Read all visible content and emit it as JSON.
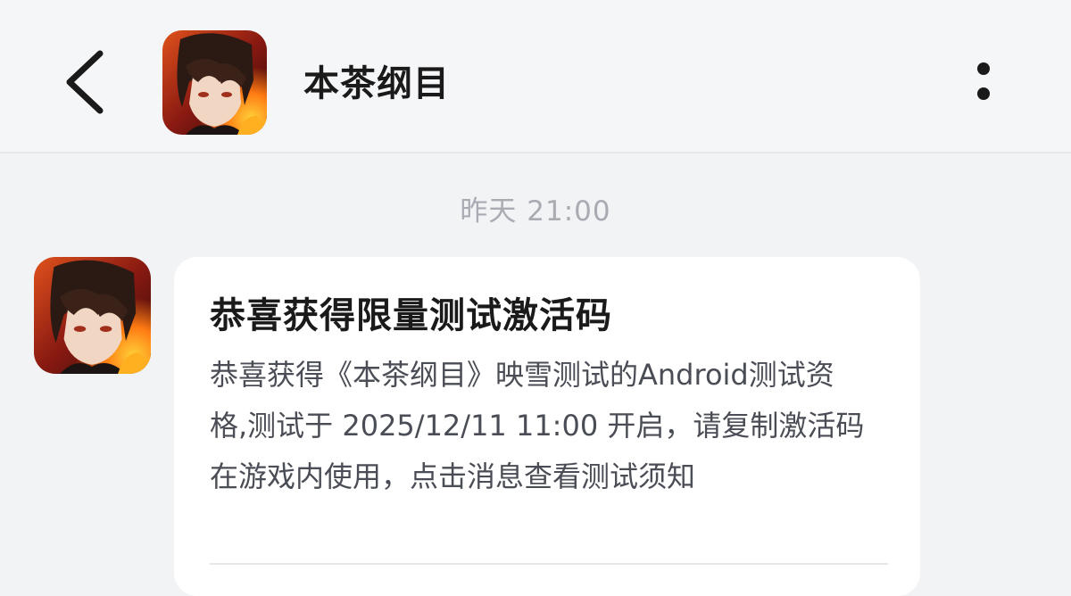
{
  "header": {
    "back_icon": "chevron-left-icon",
    "avatar_icon": "game-character-avatar",
    "title": "本茶纲目",
    "more_icon": "vertical-ellipsis-icon"
  },
  "messages": [
    {
      "timestamp": "昨天 21:00",
      "sender_avatar": "game-character-avatar",
      "title": "恭喜获得限量测试激活码",
      "body": "恭喜获得《本茶纲目》映雪测试的Android测试资格,测试于 2025/12/11 11:00 开启，请复制激活码在游戏内使用，点击消息查看测试须知"
    }
  ],
  "colors": {
    "background": "#f2f3f5",
    "header_background": "#f5f6f8",
    "bubble_background": "#ffffff",
    "title_text": "#1a1a1a",
    "body_text": "#4a4d55",
    "timestamp_text": "#a8abb2"
  }
}
